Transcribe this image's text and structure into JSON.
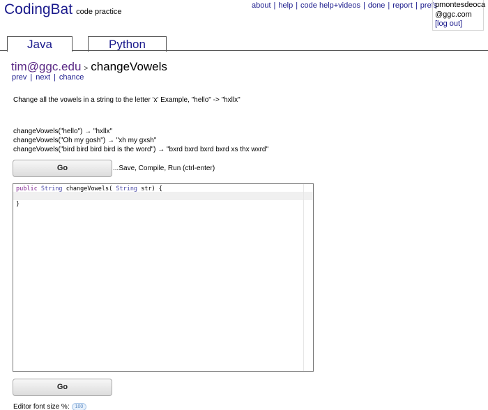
{
  "header": {
    "brand": "CodingBat",
    "tagline": "code practice",
    "nav": [
      "about",
      "help",
      "code help+videos",
      "done",
      "report",
      "prefs"
    ],
    "user_email_line1": "pmontesdeoca",
    "user_email_line2": "@ggc.com",
    "logout_label": "[log out]"
  },
  "tabs": [
    "Java",
    "Python"
  ],
  "breadcrumb": {
    "user": "tim@ggc.edu",
    "separator": ">",
    "problem": "changeVowels"
  },
  "problem_nav": [
    "prev",
    "next",
    "chance"
  ],
  "description": "Change all the vowels in a string to the letter 'x' Example, \"hello\" -> \"hxllx\"",
  "examples": [
    "changeVowels(\"hello\") → \"hxllx\"",
    "changeVowels(\"Oh my gosh\") → \"xh my gxsh\"",
    "changeVowels(\"bird bird bird bird is the word\") → \"bxrd bxrd bxrd bxrd xs thx wxrd\""
  ],
  "go_label": "Go",
  "run_hint": "...Save, Compile, Run (ctrl-enter)",
  "code": {
    "keyword": "public",
    "return_type": "String",
    "method": "changeVowels(",
    "param_type": "String",
    "param_rest": "str) {",
    "closing": "}"
  },
  "font_size_label": "Editor font size %:",
  "font_size_value": "100"
}
